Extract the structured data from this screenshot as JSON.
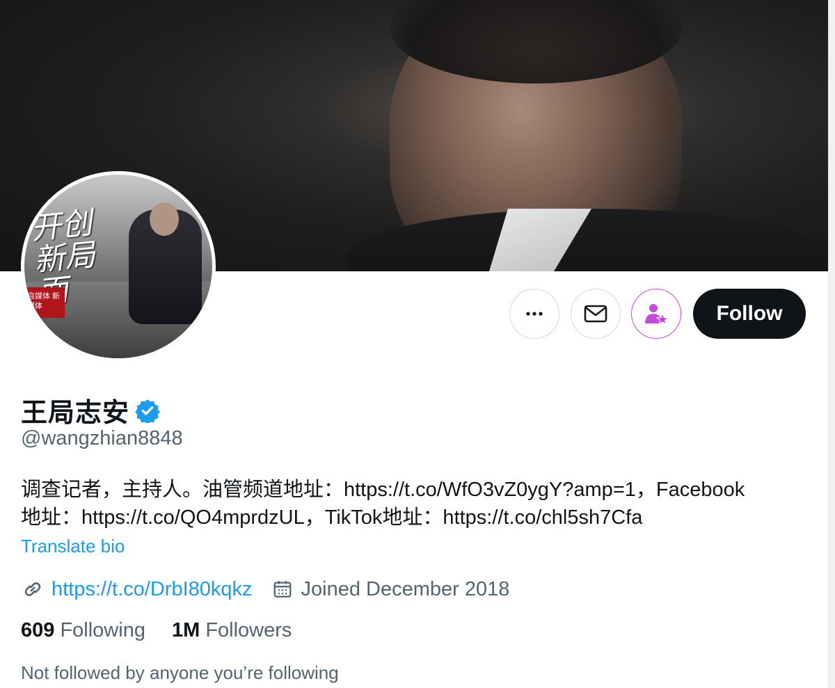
{
  "profile": {
    "display_name": "王局志安",
    "handle": "@wangzhian8848",
    "bio_line1": "调查记者，主持人。油管频道地址：https://t.co/WfO3vZ0ygY?amp=1，Facebook",
    "bio_line2": "地址：https://t.co/QO4mprdzUL，TikTok地址：https://t.co/chl5sh7Cfa",
    "translate_label": "Translate bio",
    "website": "https://t.co/DrbI80kqkz",
    "joined": "Joined December 2018",
    "following_count": "609",
    "following_label": "Following",
    "followers_count": "1M",
    "followers_label": "Followers",
    "not_followed_text": "Not followed by anyone you’re following",
    "avatar_caption": "开创新局面",
    "avatar_tag": "自媒体 新媒体"
  },
  "actions": {
    "follow_label": "Follow",
    "more_icon": "more-icon",
    "message_icon": "envelope-icon",
    "subscribe_icon": "subscribe-star-icon"
  },
  "colors": {
    "accent": "#1d9bf0",
    "text": "#0f1419",
    "secondary": "#536471",
    "subscribe": "#c04dd4",
    "follow_bg": "#0f1419"
  }
}
